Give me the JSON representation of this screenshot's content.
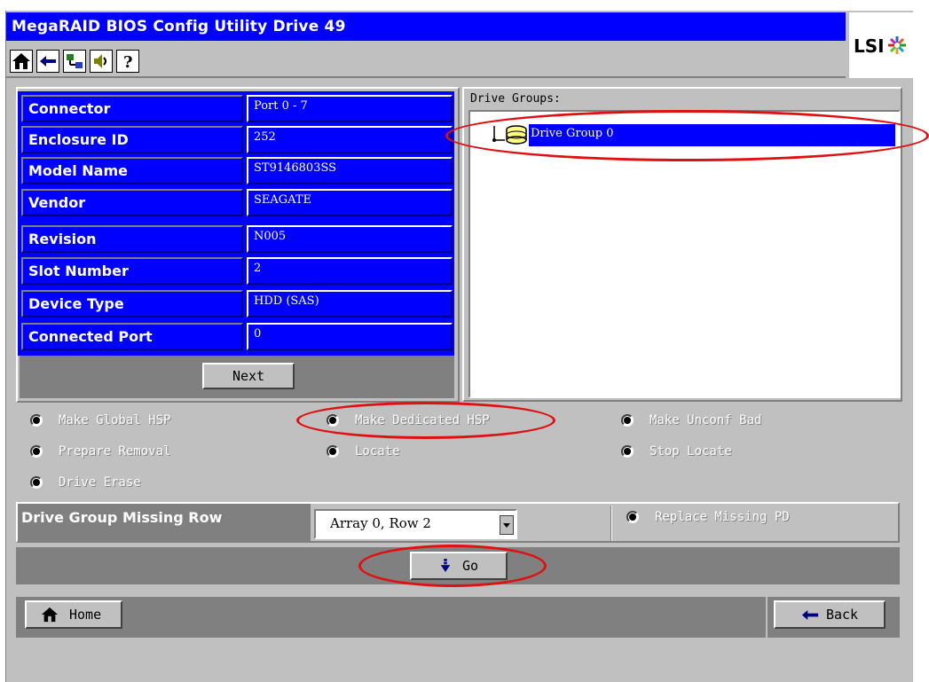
{
  "window": {
    "title": "MegaRAID BIOS Config Utility Drive 49",
    "logo_text": "LSI"
  },
  "toolbar": {
    "buttons": [
      {
        "icon": "home-icon"
      },
      {
        "icon": "back-arrow-icon"
      },
      {
        "icon": "network-icon"
      },
      {
        "icon": "speaker-icon"
      },
      {
        "icon": "help-icon"
      }
    ]
  },
  "drive_info": {
    "rows": [
      {
        "label": "Connector",
        "value": "Port 0 - 7"
      },
      {
        "label": "Enclosure ID",
        "value": "252"
      },
      {
        "label": "Model Name",
        "value": "ST9146803SS"
      },
      {
        "label": "Vendor",
        "value": "SEAGATE"
      },
      {
        "label": "Revision",
        "value": "N005"
      },
      {
        "label": "Slot Number",
        "value": "2"
      },
      {
        "label": "Device Type",
        "value": "HDD (SAS)"
      },
      {
        "label": "Connected Port",
        "value": "0"
      }
    ],
    "next_label": "Next"
  },
  "drive_groups": {
    "title": "Drive Groups:",
    "items": [
      {
        "label": "Drive Group 0"
      }
    ]
  },
  "options": [
    {
      "label": "Make Global HSP"
    },
    {
      "label": "Make Dedicated HSP"
    },
    {
      "label": "Make Unconf Bad"
    },
    {
      "label": "Prepare Removal"
    },
    {
      "label": "Locate"
    },
    {
      "label": "Stop Locate"
    },
    {
      "label": "Drive Erase"
    }
  ],
  "missing_row": {
    "label": "Drive Group Missing Row",
    "selected": "Array 0, Row 2",
    "replace_label": "Replace Missing PD"
  },
  "actions": {
    "go_label": "Go",
    "home_label": "Home",
    "back_label": "Back"
  },
  "colors": {
    "title_bar": "#0000ff",
    "panel": "#c0c0c0",
    "annotation": "#e01010"
  }
}
